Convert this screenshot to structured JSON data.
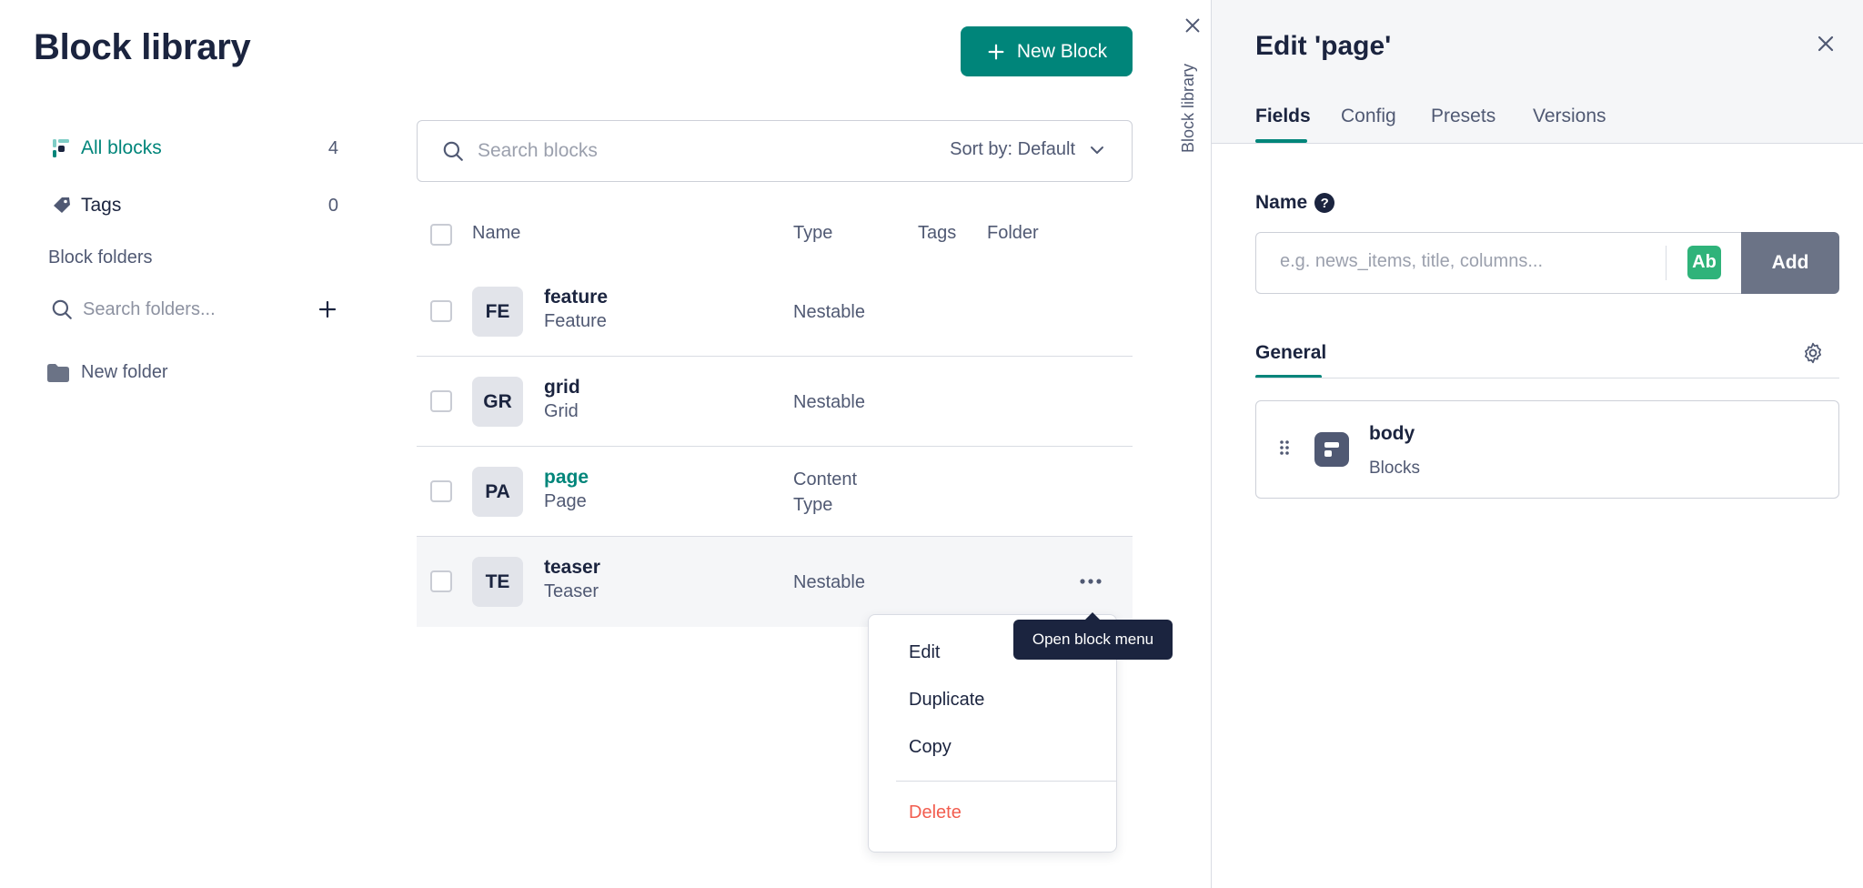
{
  "library": {
    "title": "Block library",
    "new_block_label": "New Block",
    "nav": {
      "all_blocks": {
        "label": "All blocks",
        "count": "4"
      },
      "tags": {
        "label": "Tags",
        "count": "0"
      }
    },
    "folders_title": "Block folders",
    "folder_search_placeholder": "Search folders...",
    "folders": [
      {
        "label": "New folder"
      }
    ],
    "search_placeholder": "Search blocks",
    "sort_label": "Sort by: Default",
    "columns": {
      "name": "Name",
      "type": "Type",
      "tags": "Tags",
      "folder": "Folder"
    },
    "rows": [
      {
        "initials": "FE",
        "name": "feature",
        "display": "Feature",
        "type": "Nestable"
      },
      {
        "initials": "GR",
        "name": "grid",
        "display": "Grid",
        "type": "Nestable"
      },
      {
        "initials": "PA",
        "name": "page",
        "display": "Page",
        "type_line1": "Content",
        "type_line2": "Type"
      },
      {
        "initials": "TE",
        "name": "teaser",
        "display": "Teaser",
        "type": "Nestable"
      }
    ],
    "menu": {
      "edit": "Edit",
      "duplicate": "Duplicate",
      "copy": "Copy",
      "delete": "Delete"
    },
    "tooltip": "Open block menu",
    "side_tab_label": "Block library"
  },
  "edit": {
    "title": "Edit 'page'",
    "tabs": {
      "fields": "Fields",
      "config": "Config",
      "presets": "Presets",
      "versions": "Versions"
    },
    "name_label": "Name",
    "help_glyph": "?",
    "name_placeholder": "e.g. news_items, title, columns...",
    "type_badge": "Ab",
    "add_label": "Add",
    "section_title": "General",
    "fields": [
      {
        "name": "body",
        "type": "Blocks"
      }
    ]
  },
  "colors": {
    "accent": "#00857a",
    "text": "#1b243f",
    "muted": "#505973",
    "danger": "#f25d4f",
    "badge_green": "#2fb37a",
    "add_button": "#6b7386"
  },
  "icons": [
    "plus-icon",
    "search-icon",
    "chevron-down-icon",
    "tag-icon",
    "folder-icon",
    "more-horizontal-icon",
    "close-icon",
    "help-icon",
    "gear-icon",
    "drag-handle-icon",
    "blocks-field-icon",
    "all-blocks-icon"
  ]
}
